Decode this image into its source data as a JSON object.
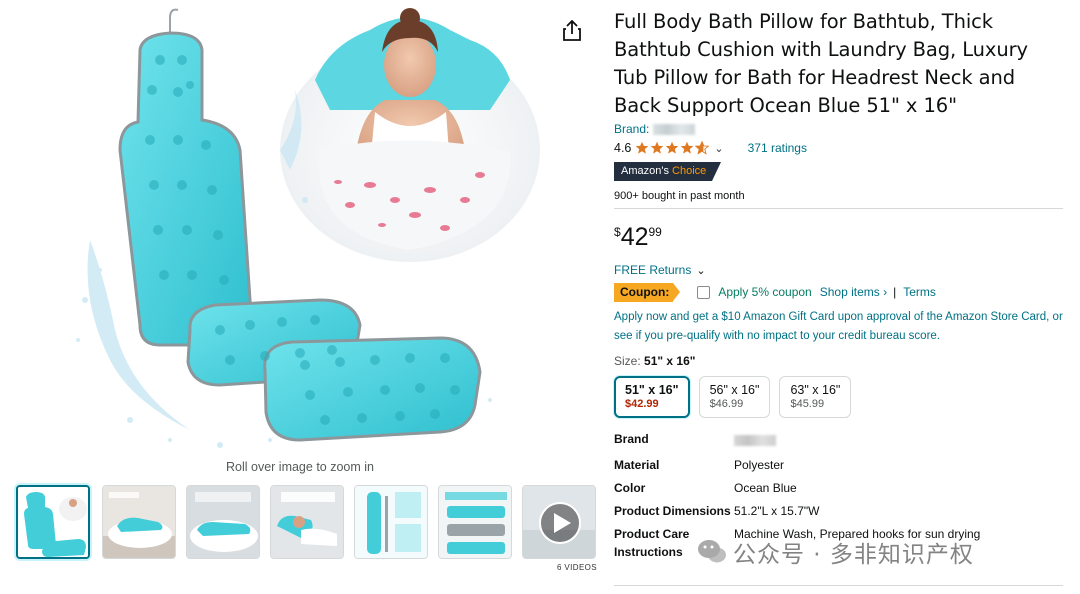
{
  "product": {
    "title": "Full Body Bath Pillow for Bathtub, Thick Bathtub Cushion with Laundry Bag, Luxury Tub Pillow for Bath for Headrest Neck and Back Support Ocean Blue 51\" x 16\"",
    "brand_prefix": "Brand:",
    "rating": "4.6",
    "stars": 4.6,
    "ratings_count": "371 ratings",
    "badge_prefix": "Amazon's",
    "badge_choice": "Choice",
    "bought": "900+ bought in past month",
    "price": {
      "symbol": "$",
      "whole": "42",
      "fraction": "99"
    },
    "free_returns": "FREE Returns",
    "coupon": {
      "tag": "Coupon:",
      "apply": "Apply 5% coupon",
      "shop": "Shop items ›",
      "separator": "|",
      "terms": "Terms"
    },
    "promo": "Apply now and get a $10 Amazon Gift Card upon approval of the Amazon Store Card, or see if you pre-qualify with no impact to your credit bureau score.",
    "size_label": "Size:",
    "size_selected": "51\" x 16\"",
    "sizes": [
      {
        "label": "51\" x 16\"",
        "price": "$42.99"
      },
      {
        "label": "56\" x 16\"",
        "price": "$46.99"
      },
      {
        "label": "63\" x 16\"",
        "price": "$45.99"
      }
    ],
    "specs": [
      {
        "key": "Brand",
        "value": ""
      },
      {
        "key": "Material",
        "value": "Polyester"
      },
      {
        "key": "Color",
        "value": "Ocean Blue"
      },
      {
        "key": "Product Dimensions",
        "value": "51.2\"L x 15.7\"W"
      },
      {
        "key": "Product Care Instructions",
        "value": "Machine Wash, Prepared hooks for sun drying"
      }
    ]
  },
  "media": {
    "zoom_hint": "Roll over image to zoom in",
    "videos_label": "6 VIDEOS",
    "thumbnails": 7
  },
  "watermark": "公众号 · 多非知识产权",
  "colors": {
    "link": "#007185",
    "price_red": "#b12704",
    "coupon_orange": "#f7a823",
    "badge_dark": "#232f3e",
    "pillow_aqua": "#4fd3df"
  }
}
